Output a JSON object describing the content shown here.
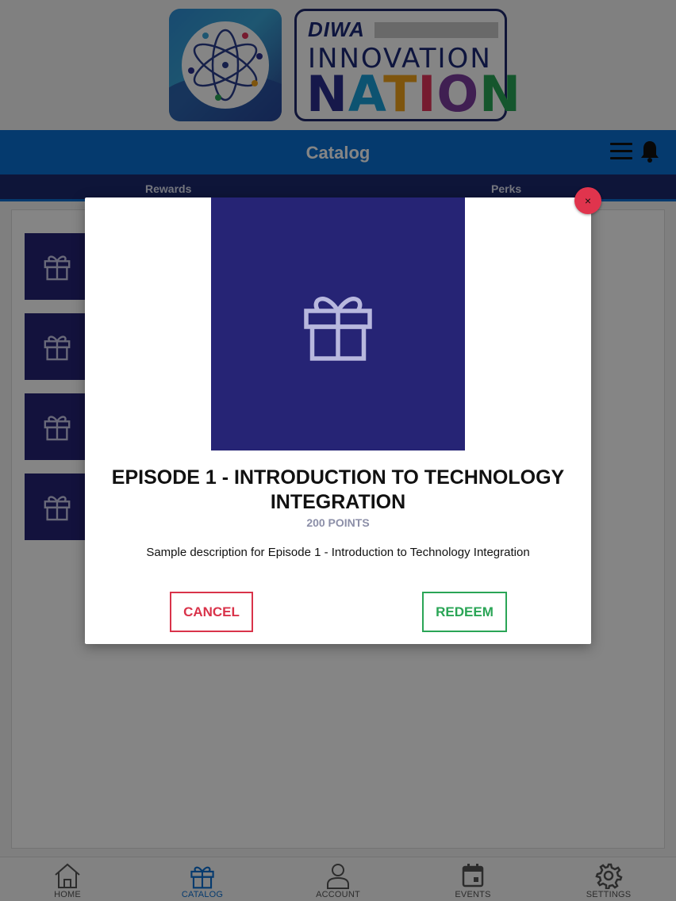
{
  "header": {
    "logo_brand": "DIWA",
    "logo_line1": "INNOVATION",
    "logo_line2": "NATION",
    "title": "Catalog",
    "menu_icon": "hamburger-menu-icon",
    "notification_icon": "bell-icon"
  },
  "subtabs": [
    {
      "label": "Rewards"
    },
    {
      "label": "Perks"
    }
  ],
  "list": {
    "item_icon": "gift-icon",
    "thumbnail_color": "#262475"
  },
  "modal": {
    "title": "EPISODE 1 - INTRODUCTION TO TECHNOLOGY INTEGRATION",
    "points": "200 POINTS",
    "description": "Sample description for Episode 1 - Introduction to Technology Integration",
    "cancel_label": "CANCEL",
    "redeem_label": "REDEEM",
    "close_label": "×"
  },
  "bottom_nav": [
    {
      "label": "HOME",
      "icon": "home-icon"
    },
    {
      "label": "CATALOG",
      "icon": "gift-icon",
      "active": true
    },
    {
      "label": "ACCOUNT",
      "icon": "user-icon"
    },
    {
      "label": "EVENTS",
      "icon": "calendar-icon"
    },
    {
      "label": "SETTINGS",
      "icon": "gear-icon"
    }
  ],
  "colors": {
    "primary": "#0b6fd3",
    "navy": "#1c2a6e",
    "danger": "#d9334a",
    "success": "#2aa556"
  }
}
